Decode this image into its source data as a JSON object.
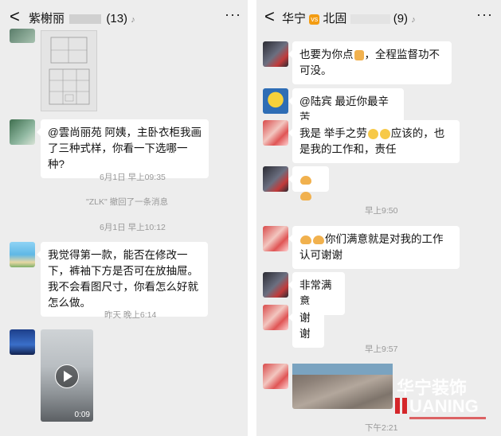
{
  "left_chat": {
    "back_label": "<",
    "title": "紫榭丽",
    "member_count": "(13)",
    "more_label": "···",
    "messages": {
      "m1": "@雲尚丽苑  阿姨，主卧衣柜我画了三种式样，你看一下选哪一种?",
      "m2": "我觉得第一款，能否在修改一下，裤袖下方是否可在放抽屉。我不会看图尺寸，你看怎么好就怎么做。"
    },
    "timestamps": {
      "t1": "6月1日 早上09:35",
      "t2": "6月1日 早上10:12",
      "t3": "昨天 晚上6:14"
    },
    "system_notice": "\"ZLK\" 撤回了一条消息",
    "video_duration": "0:09"
  },
  "right_chat": {
    "back_label": "<",
    "title_part1": "华宁",
    "vs_badge": "vs",
    "title_part2": "北固",
    "member_count": "(9)",
    "more_label": "···",
    "messages": {
      "m1": "也要为你点",
      "m1b": "，全程监督功不可没。",
      "m2": "@陆宾  最近你最辛苦",
      "m3a": "我是  举手之劳",
      "m3b": "应该的，也是我的工作和，责任",
      "m5": "你们满意就是对我的工作认可谢谢",
      "m6": "非常满意",
      "m7": "谢谢"
    },
    "timestamps": {
      "t1": "早上9:50",
      "t2": "早上9:57",
      "t3": "下午2:21"
    }
  },
  "watermark": {
    "line1": "华宁装饰",
    "line2": "UANING"
  },
  "colors": {
    "background": "#ededed",
    "bubble": "#ffffff",
    "vs_badge": "#f39c12",
    "watermark_red": "#d4262a"
  }
}
